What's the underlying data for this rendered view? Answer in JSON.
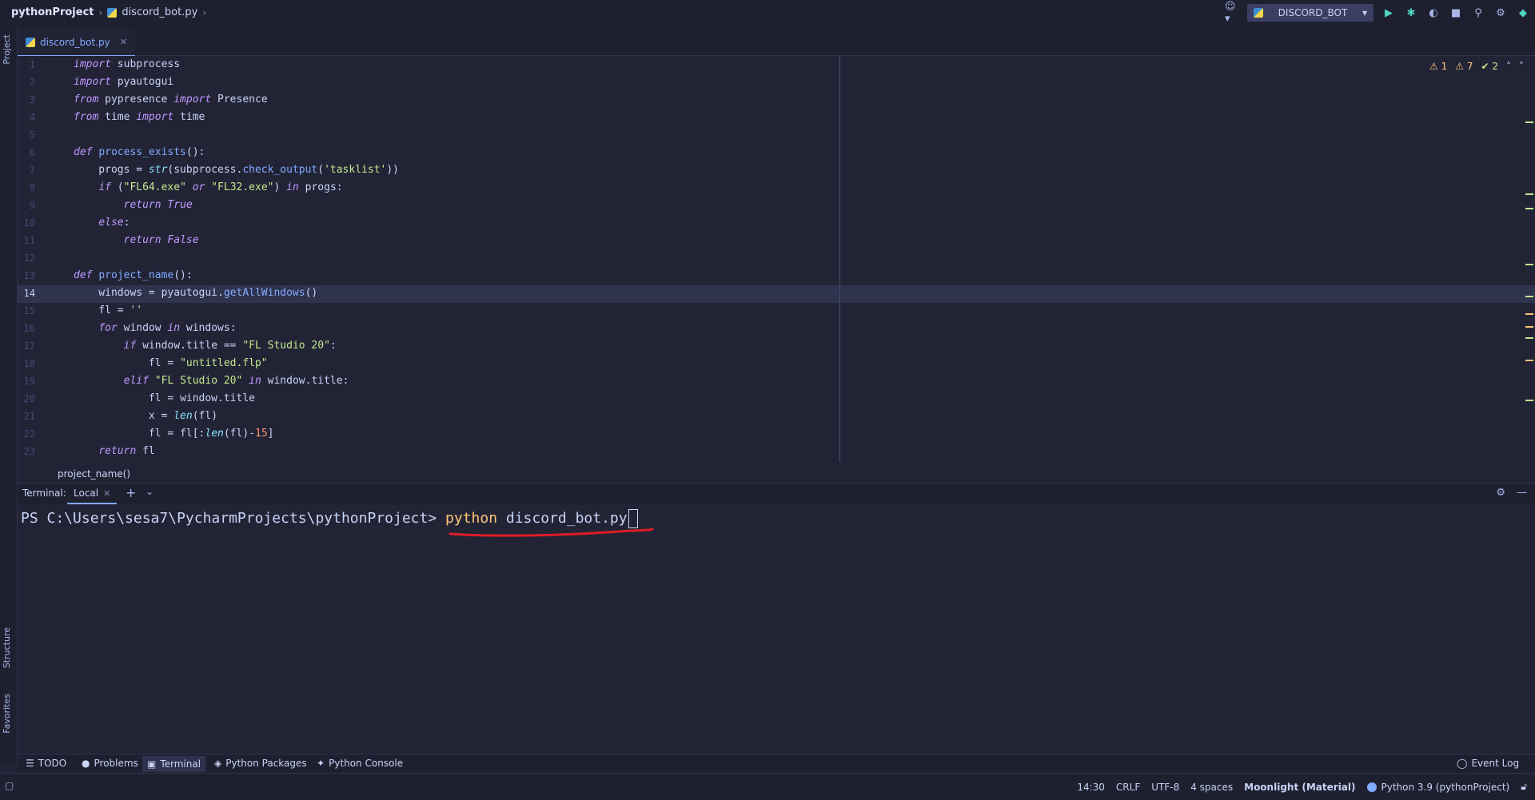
{
  "breadcrumb": {
    "project": "pythonProject",
    "file": "discord_bot.py"
  },
  "toolbar": {
    "run_config": "DISCORD_BOT"
  },
  "side_tabs": {
    "project": "Project",
    "structure": "Structure",
    "favorites": "Favorites"
  },
  "editor": {
    "tab": "discord_bot.py",
    "current_line": 14,
    "inspections": {
      "errors": "1",
      "warnings": "7",
      "typos": "2"
    },
    "breadcrumb_bottom": "project_name()",
    "lines": [
      [
        [
          "kw",
          "import"
        ],
        [
          "",
          "subprocess"
        ]
      ],
      [
        [
          "kw",
          "import"
        ],
        [
          "",
          "pyautogui"
        ]
      ],
      [
        [
          "kw",
          "from"
        ],
        [
          "",
          "pypresence"
        ],
        [
          "kw",
          "import"
        ],
        [
          "",
          "Presence"
        ]
      ],
      [
        [
          "kw",
          "from"
        ],
        [
          "",
          "time"
        ],
        [
          "kw",
          "import"
        ],
        [
          "",
          "time"
        ]
      ],
      [],
      [
        [
          "kw",
          "def"
        ],
        [
          "fn",
          "process_exists"
        ],
        [
          "",
          "():"
        ]
      ],
      [
        [
          "",
          "    progs = "
        ],
        [
          "bi",
          "str"
        ],
        [
          "",
          "(subprocess."
        ],
        [
          "fn",
          "check_output"
        ],
        [
          "",
          "("
        ],
        [
          "str",
          "'tasklist'"
        ],
        [
          "",
          "))"
        ]
      ],
      [
        [
          "",
          "    "
        ],
        [
          "kw",
          "if"
        ],
        [
          "",
          " ("
        ],
        [
          "str",
          "\"FL64.exe\""
        ],
        [
          "",
          " "
        ],
        [
          "kw",
          "or"
        ],
        [
          "",
          " "
        ],
        [
          "str",
          "\"FL32.exe\""
        ],
        [
          "",
          ") "
        ],
        [
          "kw",
          "in"
        ],
        [
          "",
          " progs:"
        ]
      ],
      [
        [
          "",
          "        "
        ],
        [
          "kw",
          "return"
        ],
        [
          "",
          " "
        ],
        [
          "kw",
          "True"
        ]
      ],
      [
        [
          "",
          "    "
        ],
        [
          "kw",
          "else"
        ],
        [
          "",
          ":"
        ]
      ],
      [
        [
          "",
          "        "
        ],
        [
          "kw",
          "return"
        ],
        [
          "",
          " "
        ],
        [
          "kw",
          "False"
        ]
      ],
      [],
      [
        [
          "kw",
          "def"
        ],
        [
          "fn",
          "project_name"
        ],
        [
          "",
          "():"
        ]
      ],
      [
        [
          "",
          "    windows = pyautogui."
        ],
        [
          "fn",
          "getAllWindows"
        ],
        [
          "",
          "()"
        ]
      ],
      [
        [
          "",
          "    fl = "
        ],
        [
          "str",
          "''"
        ]
      ],
      [
        [
          "",
          "    "
        ],
        [
          "kw",
          "for"
        ],
        [
          "",
          " window "
        ],
        [
          "kw",
          "in"
        ],
        [
          "",
          " windows:"
        ]
      ],
      [
        [
          "",
          "        "
        ],
        [
          "kw",
          "if"
        ],
        [
          "",
          " window.title == "
        ],
        [
          "str",
          "\"FL Studio 20\""
        ],
        [
          "",
          ":"
        ]
      ],
      [
        [
          "",
          "            fl = "
        ],
        [
          "str",
          "\"untitled.flp\""
        ]
      ],
      [
        [
          "",
          "        "
        ],
        [
          "kw",
          "elif"
        ],
        [
          "",
          " "
        ],
        [
          "str",
          "\"FL Studio 20\""
        ],
        [
          "",
          " "
        ],
        [
          "kw",
          "in"
        ],
        [
          "",
          " window.title:"
        ]
      ],
      [
        [
          "",
          "            fl = window.title"
        ]
      ],
      [
        [
          "",
          "            x = "
        ],
        [
          "bi",
          "len"
        ],
        [
          "",
          "(fl)"
        ]
      ],
      [
        [
          "",
          "            fl = fl[:"
        ],
        [
          "bi",
          "len"
        ],
        [
          "",
          "(fl)-"
        ],
        [
          "num",
          "15"
        ],
        [
          "",
          "]"
        ]
      ],
      [
        [
          "",
          "    "
        ],
        [
          "kw",
          "return"
        ],
        [
          "",
          " fl"
        ]
      ]
    ]
  },
  "terminal": {
    "label": "Terminal:",
    "tab": "Local",
    "prompt": "PS C:\\Users\\sesa7\\PycharmProjects\\pythonProject> ",
    "cmd_exec": "python",
    "cmd_args": " discord_bot.py"
  },
  "tool_tabs": [
    {
      "label": "TODO",
      "icon": "list-icon"
    },
    {
      "label": "Problems",
      "icon": "problems-icon"
    },
    {
      "label": "Terminal",
      "icon": "terminal-icon"
    },
    {
      "label": "Python Packages",
      "icon": "packages-icon"
    },
    {
      "label": "Python Console",
      "icon": "console-icon"
    }
  ],
  "event_log": "Event Log",
  "status": {
    "position": "14:30",
    "line_sep": "CRLF",
    "encoding": "UTF-8",
    "indent": "4 spaces",
    "theme": "Moonlight (Material)",
    "interpreter": "Python 3.9 (pythonProject)"
  },
  "colors": {
    "background": "#222436",
    "accent": "#82aaff",
    "keyword": "#c099ff",
    "string": "#c3e88d",
    "annotation": "#e01b24"
  }
}
